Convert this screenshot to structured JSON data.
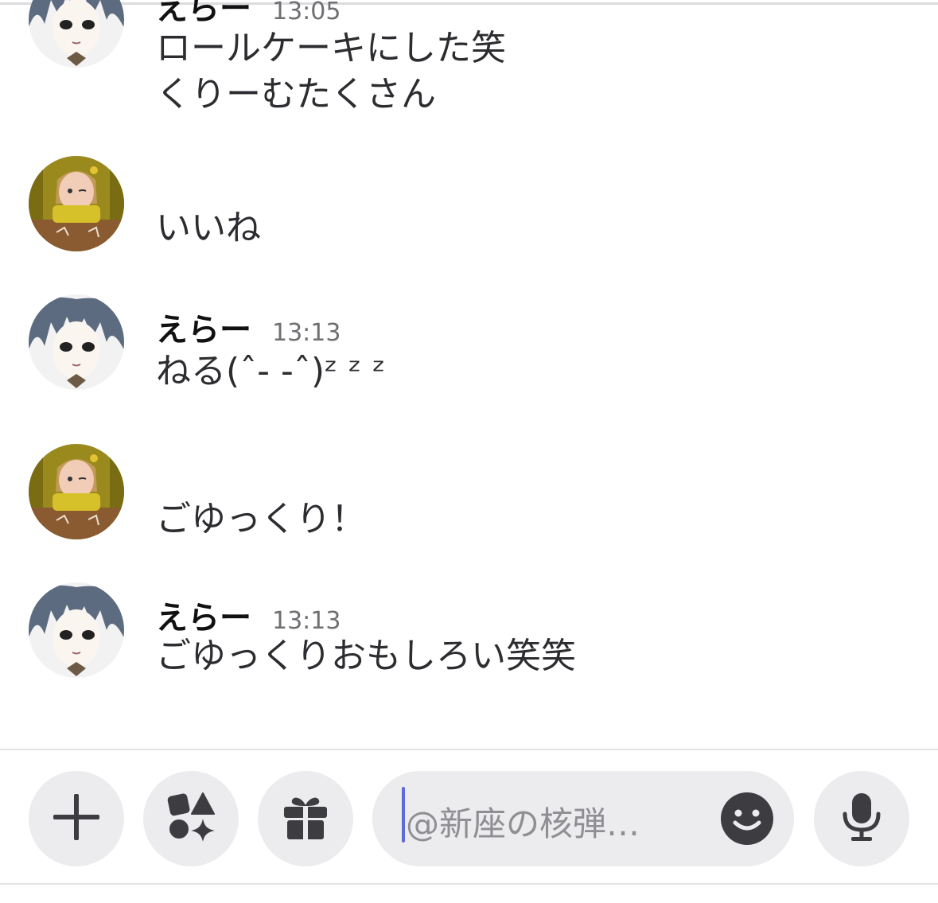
{
  "messages": [
    {
      "author": "えらー",
      "time": "13:05",
      "lines": [
        "ロールケーキにした笑",
        "くりーむたくさん"
      ],
      "avatar": "avatar-blue-hair"
    },
    {
      "author": "",
      "time": "",
      "lines": [
        "いいね"
      ],
      "avatar": "avatar-yellow-girl"
    },
    {
      "author": "えらー",
      "time": "13:13",
      "lines": [
        "ねる(ˆ- -ˆ)ᶻ ᶻ ᶻ"
      ],
      "avatar": "avatar-blue-hair"
    },
    {
      "author": "",
      "time": "",
      "lines": [
        "ごゆっくり！"
      ],
      "avatar": "avatar-yellow-girl"
    },
    {
      "author": "えらー",
      "time": "13:13",
      "lines": [
        "ごゆっくりおもしろい笑笑"
      ],
      "avatar": "avatar-blue-hair"
    }
  ],
  "composer": {
    "placeholder": "@新座の核弾…",
    "buttons": [
      "plus-icon",
      "apps-icon",
      "gift-icon",
      "smiley-icon",
      "microphone-icon"
    ]
  },
  "colors": {
    "background": "#ffffff",
    "button_bg": "#ececee",
    "icon": "#3c3c41",
    "caret": "#5f6bd6"
  }
}
